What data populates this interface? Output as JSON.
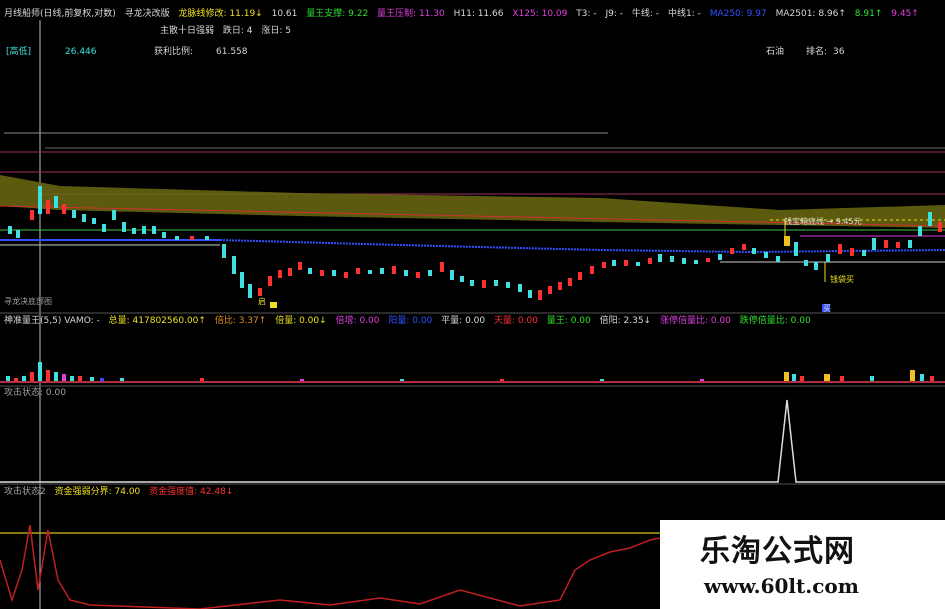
{
  "header": {
    "items": [
      {
        "label": "月线船师(日线,前复权,对数)",
        "color": "w"
      },
      {
        "label": "寻龙决改版",
        "color": "w"
      },
      {
        "label": "龙脉线修改: 11.19↓",
        "color": "y"
      },
      {
        "label": "10.61",
        "color": "w"
      },
      {
        "label": "量王支撑: 9.22",
        "color": "g"
      },
      {
        "label": "量王压制: 11.30",
        "color": "m"
      },
      {
        "label": "H11: 11.66",
        "color": "w"
      },
      {
        "label": "X125: 10.09",
        "color": "m"
      },
      {
        "label": "T3: -",
        "color": "w"
      },
      {
        "label": "J9: -",
        "color": "w"
      },
      {
        "label": "牛线: -",
        "color": "w"
      },
      {
        "label": "中线1: -",
        "color": "w"
      },
      {
        "label": "MA250: 9.97",
        "color": "b"
      },
      {
        "label": "MA2501: 8.96↑",
        "color": "w"
      },
      {
        "label": "8.91↑",
        "color": "g"
      },
      {
        "label": "9.45↑",
        "color": "m"
      }
    ],
    "second_line": [
      "主散十日强弱",
      "跌日: 4",
      "涨日: 5"
    ]
  },
  "info_bar": {
    "price_label": "[高低]",
    "price_value": "26.446",
    "ratio_label": "获利比例:",
    "ratio_value": "61.558",
    "right_label": "石油",
    "rank_label": "排名:",
    "rank_value": "36"
  },
  "chart_annotations": {
    "right_tag": "钱宝箱底线 → 9.45元",
    "buy_point": "钱袋买",
    "mark_a": "启",
    "mark_b": "买",
    "left_bottom": "寻龙决底部图"
  },
  "pane1": {
    "items": [
      {
        "label": "神准量王(5,5) VAMO: -",
        "color": "w"
      },
      {
        "label": "总量: 417802560.00↑",
        "color": "y"
      },
      {
        "label": "倍比: 3.37↑",
        "color": "o"
      },
      {
        "label": "倍量: 0.00↓",
        "color": "y"
      },
      {
        "label": "倍增: 0.00",
        "color": "m"
      },
      {
        "label": "阳量: 0.00",
        "color": "b"
      },
      {
        "label": "平量: 0.00",
        "color": "w"
      },
      {
        "label": "天量: 0.00",
        "color": "r"
      },
      {
        "label": "量王: 0.00",
        "color": "g"
      },
      {
        "label": "倍阳: 2.35↓",
        "color": "w"
      },
      {
        "label": "涨停倍量比: 0.00",
        "color": "m"
      },
      {
        "label": "跌停倍量比: 0.00",
        "color": "g"
      }
    ]
  },
  "pane2": {
    "label": "攻击状态: 0.00"
  },
  "pane3": {
    "items": [
      {
        "label": "攻击状态2",
        "color": "gr"
      },
      {
        "label": "资金强弱分界: 74.00",
        "color": "y"
      },
      {
        "label": "资金强度值: 42.48↓",
        "color": "r"
      }
    ]
  },
  "watermark": {
    "title": "乐淘公式网",
    "url": "www.60lt.com"
  }
}
